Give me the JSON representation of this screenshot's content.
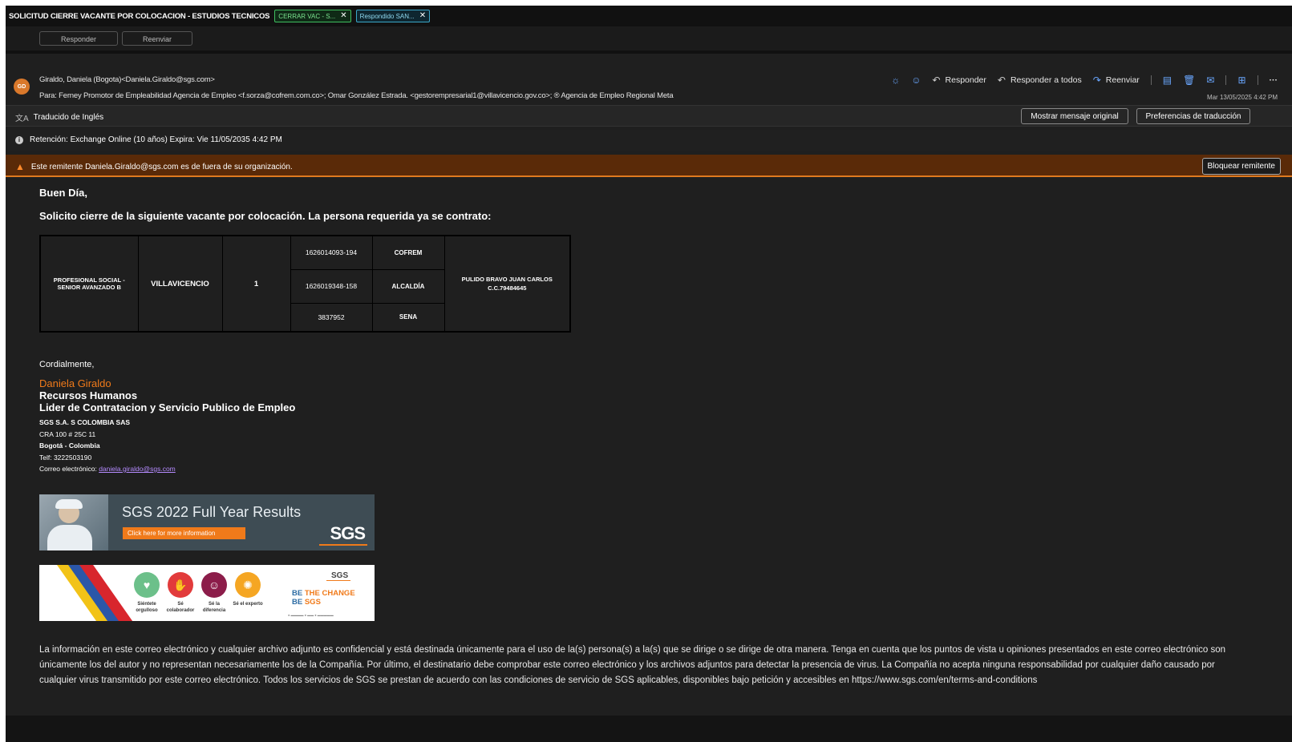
{
  "subject": "SOLICITUD CIERRE VACANTE POR COLOCACION - ESTUDIOS TECNICOS",
  "chips": [
    {
      "label": "CERRAR VAC - S...",
      "color": "#3fbf5f"
    },
    {
      "label": "Respondido SAN...",
      "color": "#3aa7c9"
    }
  ],
  "stub_buttons": {
    "reply": "Responder",
    "forward": "Reenviar"
  },
  "header": {
    "avatar_initials": "GD",
    "from": "Giraldo, Daniela (Bogota)<Daniela.Giraldo@sgs.com>",
    "to": "Para:  Ferney Promotor de Empleabilidad Agencia de Empleo <f.sorza@cofrem.com.co>;  Omar González Estrada. <gestorempresarial1@villavicencio.gov.co>; ® Agencia de Empleo Regional Meta",
    "actions": {
      "reply": "Responder",
      "reply_all": "Responder a todos",
      "forward": "Reenviar"
    },
    "date": "Mar 13/05/2025 4:42 PM"
  },
  "translation": {
    "label": "Traducido de Inglés",
    "show_original": "Mostrar mensaje original",
    "preferences": "Preferencias de traducción"
  },
  "retention": "Retención: Exchange Online (10 años) Expira: Vie 11/05/2035 4:42 PM",
  "warning": {
    "text": "Este remitente Daniela.Giraldo@sgs.com es de fuera de su organización.",
    "block_button": "Bloquear remitente"
  },
  "body": {
    "greeting": "Buen Día,",
    "intro": "Solicito cierre de la siguiente vacante por colocación. La persona requerida ya se contrato:",
    "table": {
      "position": "PROFESIONAL SOCIAL - SENIOR AVANZADO B",
      "city": "VILLAVICENCIO",
      "quantity": "1",
      "rows": [
        {
          "code": "1626014093-194",
          "source": "COFREM"
        },
        {
          "code": "1626019348-158",
          "source": "ALCALDÍA"
        },
        {
          "code": "3837952",
          "source": "SENA"
        }
      ],
      "person": "PULIDO BRAVO JUAN CARLOS",
      "person_id": "C.C.79484645"
    },
    "closing": "Cordialmente,",
    "signature": {
      "name": "Daniela Giraldo",
      "dept": "Recursos Humanos",
      "role": "Lider de Contratacion y Servicio Publico de Empleo",
      "company": "SGS S.A. S COLOMBIA SAS",
      "address": "CRA 100 # 25C 11",
      "city": "Bogotá - Colombia",
      "phone": "Telf: 3222503190",
      "email_label": "Correo electrónico:",
      "email": "daniela.giraldo@sgs.com"
    },
    "banner1": {
      "title": "SGS 2022 Full Year Results",
      "cta": "Click here for more information",
      "logo": "SGS"
    },
    "banner2": {
      "logo": "SGS",
      "values": [
        {
          "label": "Siéntete orgulloso",
          "color": "#6cc08a"
        },
        {
          "label": "Sé colaborador",
          "color": "#e23b3b"
        },
        {
          "label": "Sé la diferencia",
          "color": "#8c1d4a"
        },
        {
          "label": "Sé el experto",
          "color": "#f5a623"
        }
      ],
      "slogan_1": "BE ",
      "slogan_1b": "THE CHANGE",
      "slogan_2": "BE ",
      "slogan_2b": "SGS"
    },
    "disclaimer": "La información en este correo electrónico y cualquier archivo adjunto es confidencial y está destinada únicamente para el uso de la(s) persona(s) a la(s) que se dirige o se dirige de otra manera. Tenga en cuenta que los puntos de vista u opiniones presentados en este correo electrónico son únicamente los del autor y no representan necesariamente los de la Compañía. Por último, el destinatario debe comprobar este correo electrónico y los archivos adjuntos para detectar la presencia de virus. La Compañía no acepta ninguna responsabilidad por cualquier daño causado por cualquier virus transmitido por este correo electrónico. Todos los servicios de SGS se prestan de acuerdo con las condiciones de servicio de SGS aplicables, disponibles bajo petición y accesibles en https://www.sgs.com/en/terms-and-conditions"
  }
}
